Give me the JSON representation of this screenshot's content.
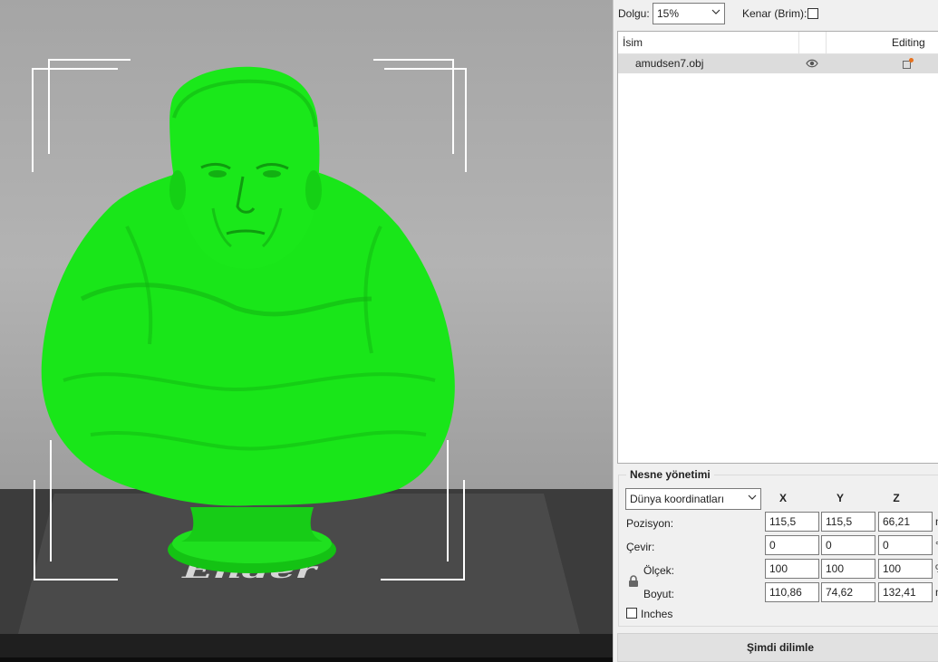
{
  "settings": {
    "infill_label": "Dolgu:",
    "infill_value": "15%",
    "brim_label": "Kenar (Brim):"
  },
  "object_list": {
    "col_name": "İsim",
    "col_editing": "Editing",
    "rows": [
      {
        "name": "amudsen7.obj",
        "visible_icon": "eye-icon",
        "edit_icon": "edit-settings-icon"
      }
    ]
  },
  "object_manipulation": {
    "title": "Nesne yönetimi",
    "coord_system": "Dünya koordinatları",
    "axes": [
      "X",
      "Y",
      "Z"
    ],
    "position": {
      "label": "Pozisyon:",
      "x": "115,5",
      "y": "115,5",
      "z": "66,21",
      "unit": "mm"
    },
    "rotation": {
      "label": "Çevir:",
      "x": "0",
      "y": "0",
      "z": "0",
      "unit": "°"
    },
    "scale": {
      "label": "Ölçek:",
      "x": "100",
      "y": "100",
      "z": "100",
      "unit": "%"
    },
    "size": {
      "label": "Boyut:",
      "x": "110,86",
      "y": "74,62",
      "z": "132,41",
      "unit": "mm"
    },
    "lock_icon": "lock-icon",
    "inches_label": "Inches"
  },
  "actions": {
    "slice_now": "Şimdi dilimle"
  },
  "viewport": {
    "bed_logo_text": "Ender",
    "model_color": "#19e619",
    "bed_color": "#3a3a3a",
    "accent_color": "#e8711c"
  }
}
